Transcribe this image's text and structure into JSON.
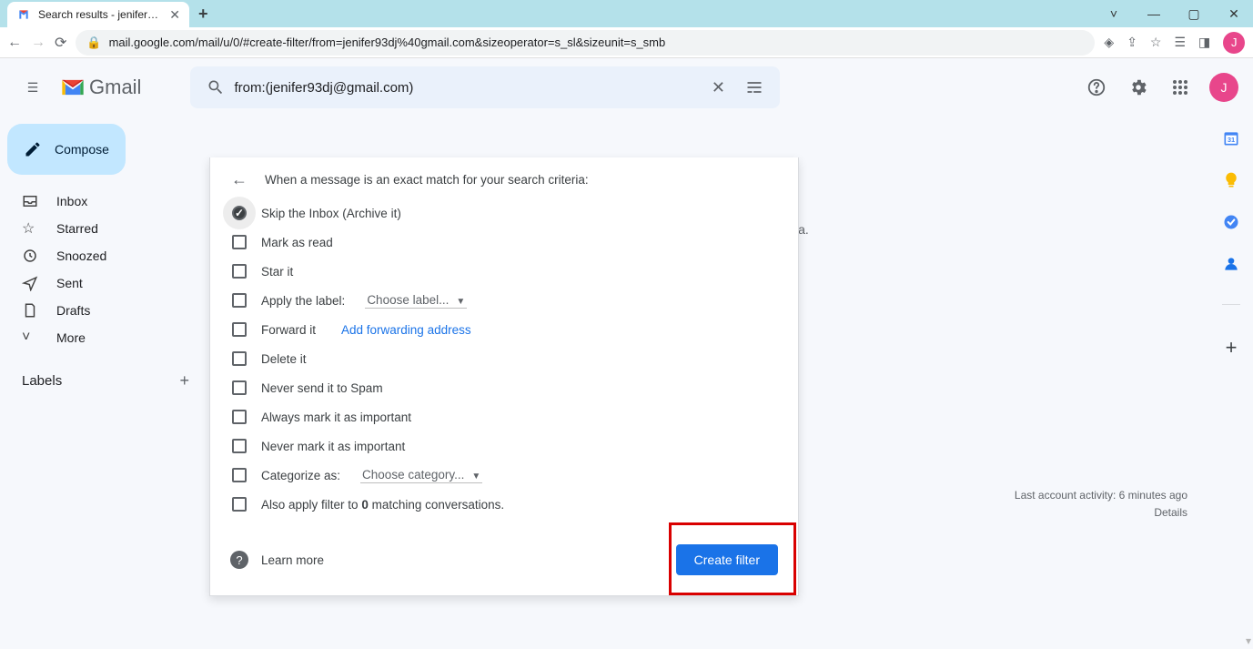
{
  "browser": {
    "tab_title": "Search results - jeniferswagathdj",
    "url": "mail.google.com/mail/u/0/#create-filter/from=jenifer93dj%40gmail.com&sizeoperator=s_sl&sizeunit=s_smb",
    "avatar_letter": "J"
  },
  "gmail": {
    "logo_text": "Gmail",
    "compose": "Compose",
    "search_value": "from:(jenifer93dj@gmail.com)",
    "nav": {
      "inbox": "Inbox",
      "starred": "Starred",
      "snoozed": "Snoozed",
      "sent": "Sent",
      "drafts": "Drafts",
      "more": "More"
    },
    "labels_heading": "Labels",
    "profile_letter": "J"
  },
  "filter_panel": {
    "header": "When a message is an exact match for your search criteria:",
    "options": {
      "skip_inbox": "Skip the Inbox (Archive it)",
      "mark_read": "Mark as read",
      "star_it": "Star it",
      "apply_label": "Apply the label:",
      "choose_label": "Choose label...",
      "forward_it": "Forward it",
      "add_forward": "Add forwarding address",
      "delete_it": "Delete it",
      "never_spam": "Never send it to Spam",
      "always_important": "Always mark it as important",
      "never_important": "Never mark it as important",
      "categorize_as": "Categorize as:",
      "choose_category": "Choose category...",
      "also_apply_pre": "Also apply filter to ",
      "also_apply_count": "0",
      "also_apply_post": " matching conversations."
    },
    "learn_more": "Learn more",
    "create_filter": "Create filter"
  },
  "content": {
    "obscured_fragment": "ia."
  },
  "footer": {
    "activity": "Last account activity: 6 minutes ago",
    "details": "Details"
  },
  "side_panel": {
    "calendar": "calendar-icon",
    "keep": "keep-icon",
    "tasks": "tasks-icon",
    "contacts": "contacts-icon",
    "add": "add-icon"
  }
}
